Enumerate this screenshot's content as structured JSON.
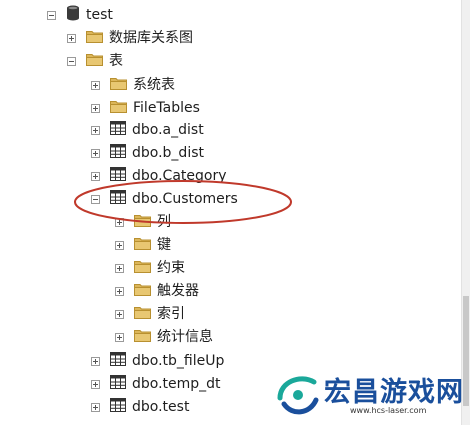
{
  "tree": [
    {
      "key": "test",
      "label": "test",
      "icon": "database-icon",
      "toggle": "minus",
      "indent": 0
    },
    {
      "key": "diagrams",
      "label": "数据库关系图",
      "icon": "folder-icon",
      "toggle": "plus",
      "indent": 1
    },
    {
      "key": "tables",
      "label": "表",
      "icon": "folder-icon",
      "toggle": "minus",
      "indent": 1
    },
    {
      "key": "system-tables",
      "label": "系统表",
      "icon": "folder-icon",
      "toggle": "plus",
      "indent": 2
    },
    {
      "key": "filetables",
      "label": "FileTables",
      "icon": "folder-icon",
      "toggle": "plus",
      "indent": 2
    },
    {
      "key": "a-dist",
      "label": "dbo.a_dist",
      "icon": "table-icon",
      "toggle": "plus",
      "indent": 2
    },
    {
      "key": "b-dist",
      "label": "dbo.b_dist",
      "icon": "table-icon",
      "toggle": "plus",
      "indent": 2
    },
    {
      "key": "category",
      "label": "dbo.Category",
      "icon": "table-icon",
      "toggle": "plus",
      "indent": 2
    },
    {
      "key": "customers",
      "label": "dbo.Customers",
      "icon": "table-icon",
      "toggle": "minus",
      "indent": 2
    },
    {
      "key": "columns",
      "label": "列",
      "icon": "folder-icon",
      "toggle": "plus",
      "indent": 3
    },
    {
      "key": "keys",
      "label": "键",
      "icon": "folder-icon",
      "toggle": "plus",
      "indent": 3
    },
    {
      "key": "constraints",
      "label": "约束",
      "icon": "folder-icon",
      "toggle": "plus",
      "indent": 3
    },
    {
      "key": "triggers",
      "label": "触发器",
      "icon": "folder-icon",
      "toggle": "plus",
      "indent": 3
    },
    {
      "key": "indexes",
      "label": "索引",
      "icon": "folder-icon",
      "toggle": "plus",
      "indent": 3
    },
    {
      "key": "statistics",
      "label": "统计信息",
      "icon": "folder-icon",
      "toggle": "plus",
      "indent": 3
    },
    {
      "key": "tb-fileup",
      "label": "dbo.tb_fileUp",
      "icon": "table-icon",
      "toggle": "plus",
      "indent": 2
    },
    {
      "key": "temp-dt",
      "label": "dbo.temp_dt",
      "icon": "table-icon",
      "toggle": "plus",
      "indent": 2
    },
    {
      "key": "dbo-test",
      "label": "dbo.test",
      "icon": "table-icon",
      "toggle": "plus",
      "indent": 2
    }
  ],
  "watermark": {
    "title": "宏昌游戏网",
    "url": "www.hcs-laser.com"
  },
  "colors": {
    "highlight": "#c0392b",
    "folder": "#dcb65a",
    "table": "#333333",
    "database": "#3a3a3a",
    "watermark": "#1a4f9c"
  }
}
